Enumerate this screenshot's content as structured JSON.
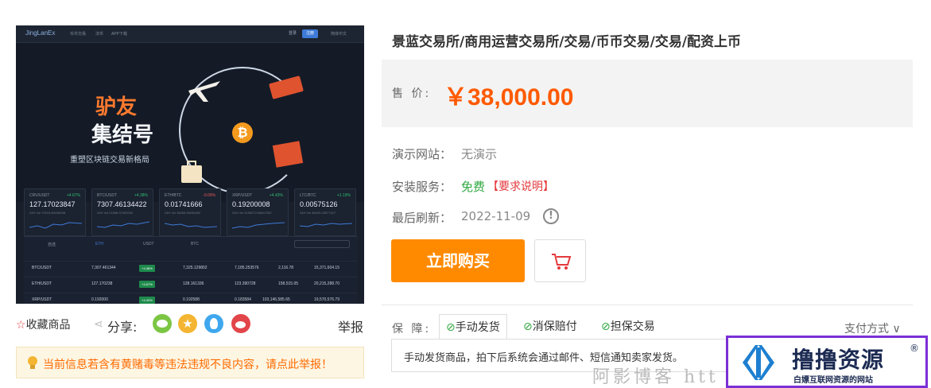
{
  "preview": {
    "logo": "JingLanEx",
    "nav": [
      "币币交易",
      "法币",
      "APP下载"
    ],
    "nav_btns": [
      "登录",
      "注册"
    ],
    "lang": "简体中文",
    "banner_title_1": "驴友",
    "banner_title_2": "集结号",
    "banner_sub": "重塑区块链交易新格局",
    "tickers": [
      {
        "pair": "CRV/USDT",
        "chg": "+4.67%",
        "price": "127.17023847",
        "sub": "24H Vol 79215.80156008"
      },
      {
        "pair": "BTC/USDT",
        "chg": "+4.38%",
        "price": "7307.46134422",
        "sub": "24H Vol 21556.37402000"
      },
      {
        "pair": "ETH/BTC",
        "chg": "-0.00%",
        "price": "0.01741666",
        "sub": "24H Vol 38265.55263492"
      },
      {
        "pair": "XRP/USDT",
        "chg": "+4.43%",
        "price": "0.19200008",
        "sub": "24H Vol 4155270.84847302"
      },
      {
        "pair": "LTC/BTC",
        "chg": "+1.19%",
        "price": "0.00575126",
        "sub": "24H Vol 36015.28577417"
      }
    ],
    "market_tabs": [
      "自选",
      "ETH",
      "USDT",
      "BTC"
    ],
    "market_rows": [
      {
        "pair": "BTC/USDT",
        "price": "7,307.461344",
        "chg": "+4.38%",
        "c3": "7,325.129802",
        "c4": "7,185.253576",
        "c5": "2,116.78",
        "c6": "15,371,604.15"
      },
      {
        "pair": "ETH/USDT",
        "price": "127.170238",
        "chg": "+4.67%",
        "c3": "128.161336",
        "c4": "123.390728",
        "c5": "158,515.05",
        "c6": "20,215,288.70"
      },
      {
        "pair": "XRP/USDT",
        "price": "0.192000",
        "chg": "+4.43%",
        "c3": "0.192588",
        "c4": "0.183584",
        "c5": "103,146,585.65",
        "c6": "19,570,576.79"
      }
    ]
  },
  "actions": {
    "collect": "收藏商品",
    "share": "分享:",
    "report": "举报"
  },
  "warning": "当前信息若含有黄赌毒等违法违规不良内容，请点此举报！",
  "product": {
    "title": "景蓝交易所/商用运营交易所/交易/币币交易/交易/配资上币",
    "price_label": "售 价:",
    "price": "￥38,000.00",
    "demo_label": "演示网站：",
    "demo_value": "无演示",
    "install_label": "安装服务：",
    "install_value": "免费",
    "install_note": "【要求说明】",
    "refresh_label": "最后刷新：",
    "refresh_value": "2022-11-09",
    "buy_label": "立即购买"
  },
  "guarantee": {
    "label": "保 障:",
    "tabs": [
      "手动发货",
      "消保赔付",
      "担保交易"
    ],
    "pay_method": "支付方式",
    "description": "手动发货商品，拍下后系统会通过邮件、短信通知卖家发货。"
  },
  "watermark": "阿影博客 htt",
  "site_logo": {
    "main": "撸撸资源",
    "sub": "白嫖互联网资源的网站",
    "reg": "®"
  },
  "colors": {
    "price": "#ff5a00",
    "buy_button": "#ff8a00",
    "warning_text": "#ff6a00",
    "free_green": "#2fa83f",
    "note_red": "#e4393c",
    "logo_border": "#7b2fd6",
    "check_green": "#2fa83f"
  }
}
